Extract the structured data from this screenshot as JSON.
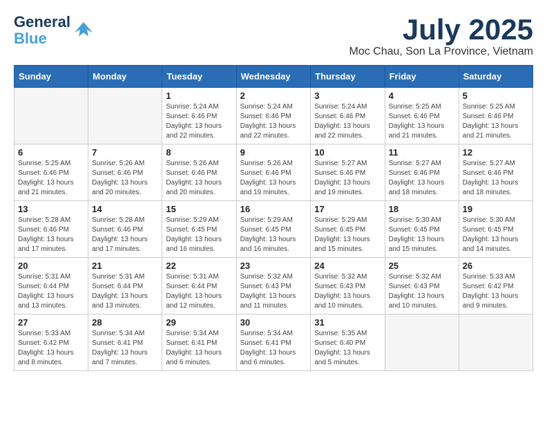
{
  "header": {
    "logo_line1": "General",
    "logo_line2": "Blue",
    "month_title": "July 2025",
    "location": "Moc Chau, Son La Province, Vietnam"
  },
  "days_of_week": [
    "Sunday",
    "Monday",
    "Tuesday",
    "Wednesday",
    "Thursday",
    "Friday",
    "Saturday"
  ],
  "weeks": [
    [
      {
        "day": "",
        "info": ""
      },
      {
        "day": "",
        "info": ""
      },
      {
        "day": "1",
        "info": "Sunrise: 5:24 AM\nSunset: 6:46 PM\nDaylight: 13 hours and 22 minutes."
      },
      {
        "day": "2",
        "info": "Sunrise: 5:24 AM\nSunset: 6:46 PM\nDaylight: 13 hours and 22 minutes."
      },
      {
        "day": "3",
        "info": "Sunrise: 5:24 AM\nSunset: 6:46 PM\nDaylight: 13 hours and 22 minutes."
      },
      {
        "day": "4",
        "info": "Sunrise: 5:25 AM\nSunset: 6:46 PM\nDaylight: 13 hours and 21 minutes."
      },
      {
        "day": "5",
        "info": "Sunrise: 5:25 AM\nSunset: 6:46 PM\nDaylight: 13 hours and 21 minutes."
      }
    ],
    [
      {
        "day": "6",
        "info": "Sunrise: 5:25 AM\nSunset: 6:46 PM\nDaylight: 13 hours and 21 minutes."
      },
      {
        "day": "7",
        "info": "Sunrise: 5:26 AM\nSunset: 6:46 PM\nDaylight: 13 hours and 20 minutes."
      },
      {
        "day": "8",
        "info": "Sunrise: 5:26 AM\nSunset: 6:46 PM\nDaylight: 13 hours and 20 minutes."
      },
      {
        "day": "9",
        "info": "Sunrise: 5:26 AM\nSunset: 6:46 PM\nDaylight: 13 hours and 19 minutes."
      },
      {
        "day": "10",
        "info": "Sunrise: 5:27 AM\nSunset: 6:46 PM\nDaylight: 13 hours and 19 minutes."
      },
      {
        "day": "11",
        "info": "Sunrise: 5:27 AM\nSunset: 6:46 PM\nDaylight: 13 hours and 18 minutes."
      },
      {
        "day": "12",
        "info": "Sunrise: 5:27 AM\nSunset: 6:46 PM\nDaylight: 13 hours and 18 minutes."
      }
    ],
    [
      {
        "day": "13",
        "info": "Sunrise: 5:28 AM\nSunset: 6:46 PM\nDaylight: 13 hours and 17 minutes."
      },
      {
        "day": "14",
        "info": "Sunrise: 5:28 AM\nSunset: 6:46 PM\nDaylight: 13 hours and 17 minutes."
      },
      {
        "day": "15",
        "info": "Sunrise: 5:29 AM\nSunset: 6:45 PM\nDaylight: 13 hours and 16 minutes."
      },
      {
        "day": "16",
        "info": "Sunrise: 5:29 AM\nSunset: 6:45 PM\nDaylight: 13 hours and 16 minutes."
      },
      {
        "day": "17",
        "info": "Sunrise: 5:29 AM\nSunset: 6:45 PM\nDaylight: 13 hours and 15 minutes."
      },
      {
        "day": "18",
        "info": "Sunrise: 5:30 AM\nSunset: 6:45 PM\nDaylight: 13 hours and 15 minutes."
      },
      {
        "day": "19",
        "info": "Sunrise: 5:30 AM\nSunset: 6:45 PM\nDaylight: 13 hours and 14 minutes."
      }
    ],
    [
      {
        "day": "20",
        "info": "Sunrise: 5:31 AM\nSunset: 6:44 PM\nDaylight: 13 hours and 13 minutes."
      },
      {
        "day": "21",
        "info": "Sunrise: 5:31 AM\nSunset: 6:44 PM\nDaylight: 13 hours and 13 minutes."
      },
      {
        "day": "22",
        "info": "Sunrise: 5:31 AM\nSunset: 6:44 PM\nDaylight: 13 hours and 12 minutes."
      },
      {
        "day": "23",
        "info": "Sunrise: 5:32 AM\nSunset: 6:43 PM\nDaylight: 13 hours and 11 minutes."
      },
      {
        "day": "24",
        "info": "Sunrise: 5:32 AM\nSunset: 6:43 PM\nDaylight: 13 hours and 10 minutes."
      },
      {
        "day": "25",
        "info": "Sunrise: 5:32 AM\nSunset: 6:43 PM\nDaylight: 13 hours and 10 minutes."
      },
      {
        "day": "26",
        "info": "Sunrise: 5:33 AM\nSunset: 6:42 PM\nDaylight: 13 hours and 9 minutes."
      }
    ],
    [
      {
        "day": "27",
        "info": "Sunrise: 5:33 AM\nSunset: 6:42 PM\nDaylight: 13 hours and 8 minutes."
      },
      {
        "day": "28",
        "info": "Sunrise: 5:34 AM\nSunset: 6:41 PM\nDaylight: 13 hours and 7 minutes."
      },
      {
        "day": "29",
        "info": "Sunrise: 5:34 AM\nSunset: 6:41 PM\nDaylight: 13 hours and 6 minutes."
      },
      {
        "day": "30",
        "info": "Sunrise: 5:34 AM\nSunset: 6:41 PM\nDaylight: 13 hours and 6 minutes."
      },
      {
        "day": "31",
        "info": "Sunrise: 5:35 AM\nSunset: 6:40 PM\nDaylight: 13 hours and 5 minutes."
      },
      {
        "day": "",
        "info": ""
      },
      {
        "day": "",
        "info": ""
      }
    ]
  ]
}
